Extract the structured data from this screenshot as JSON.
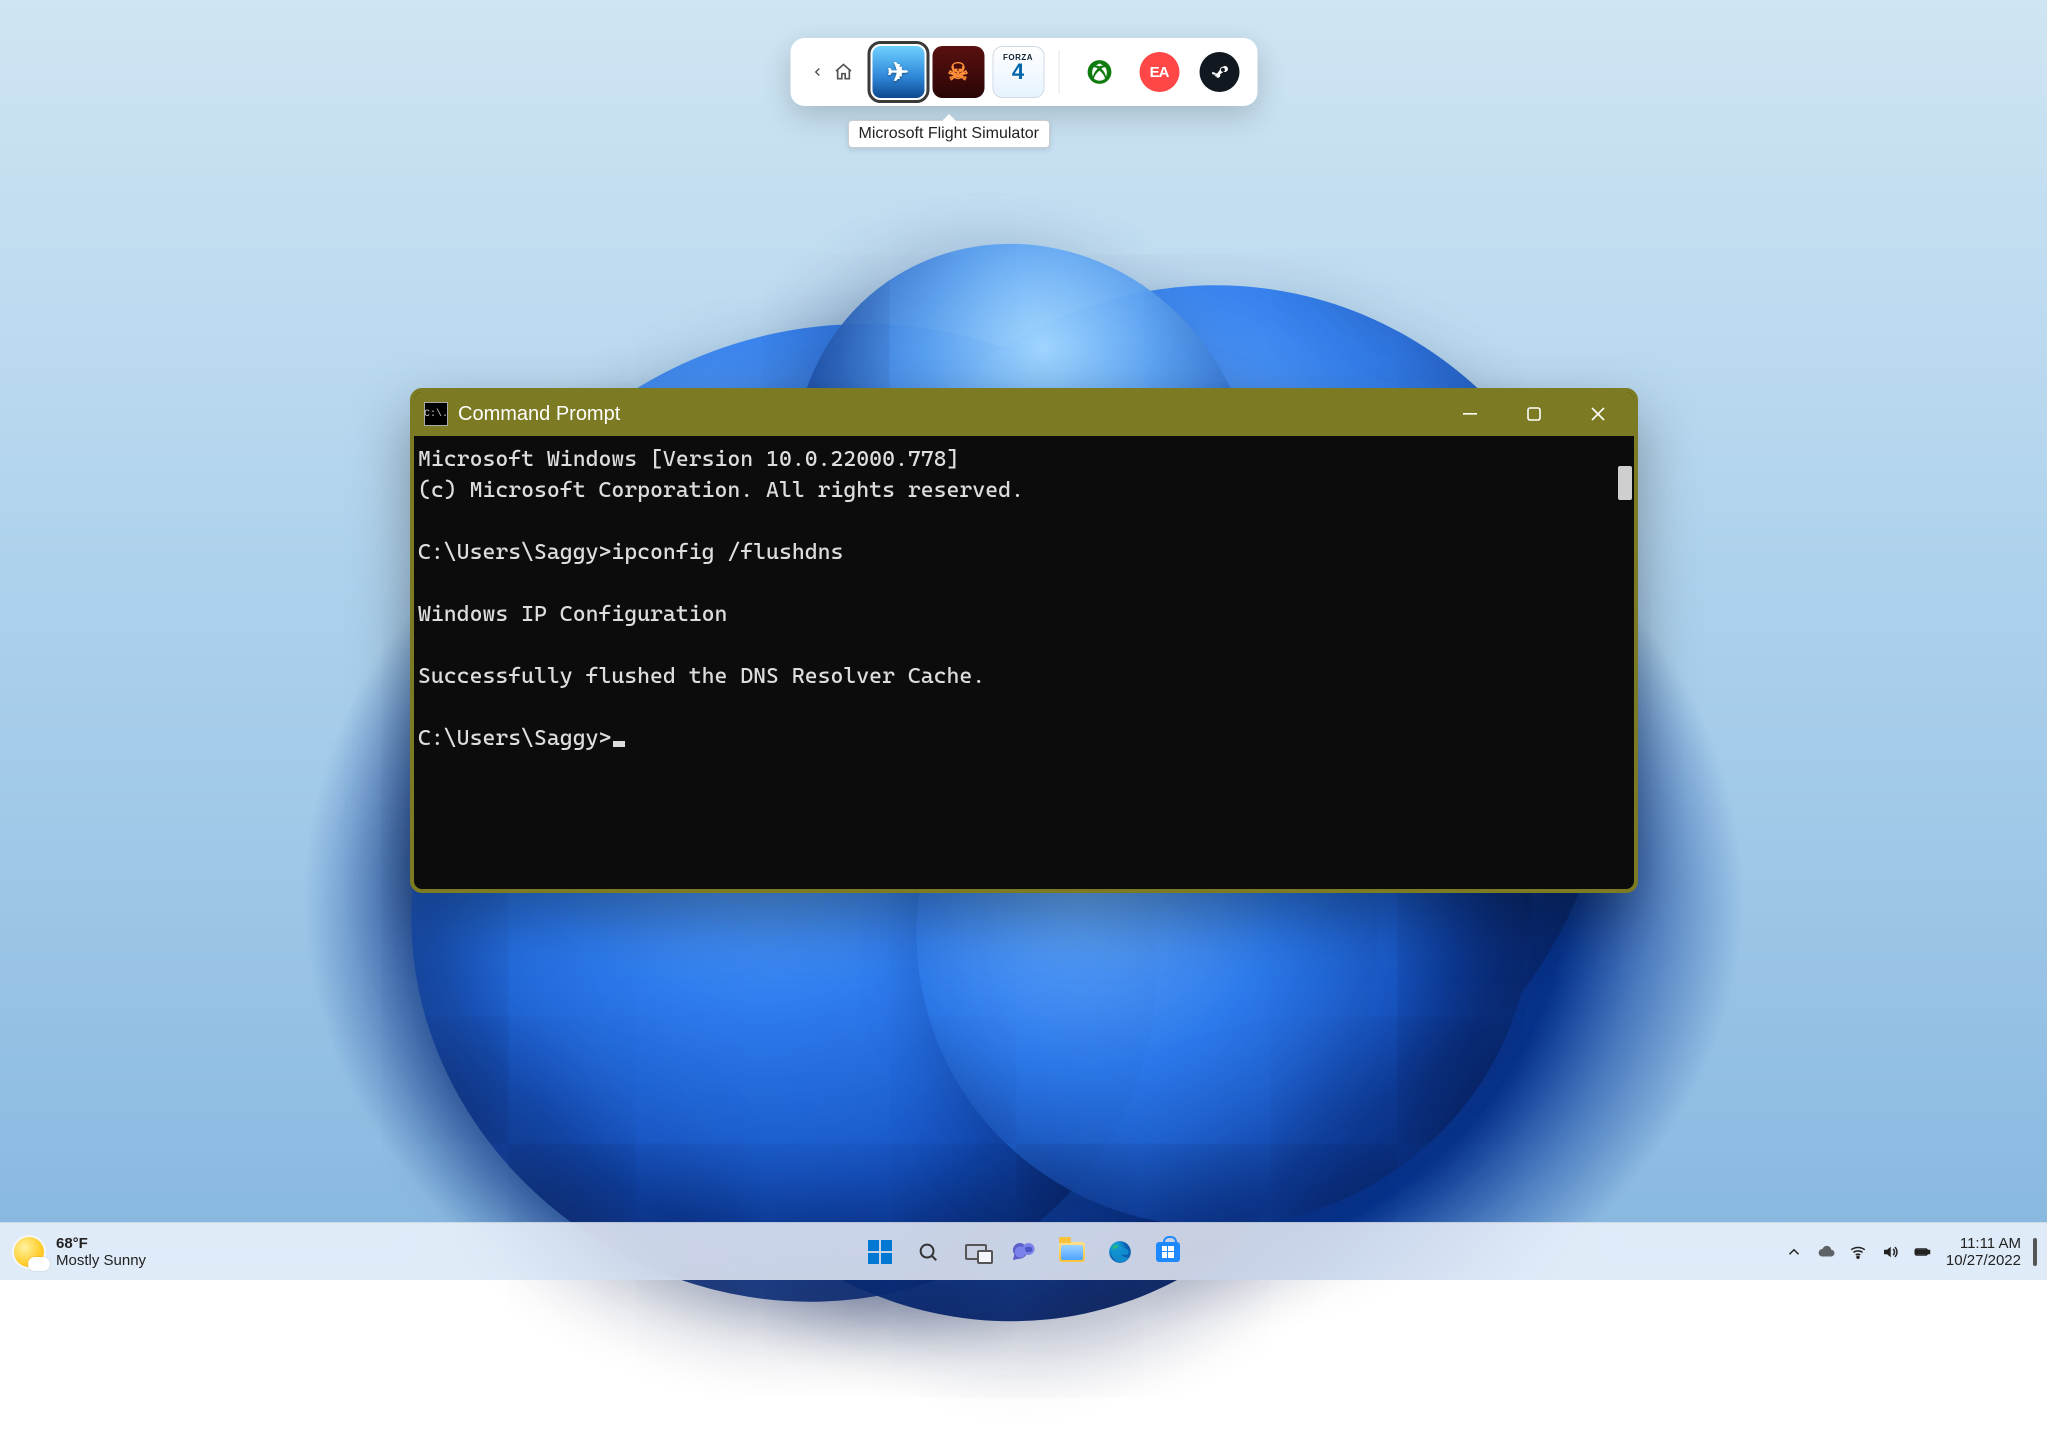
{
  "gamebar": {
    "tiles": [
      {
        "id": "msfs",
        "name": "Microsoft Flight Simulator",
        "selected": true
      },
      {
        "id": "doom",
        "name": "DOOM"
      },
      {
        "id": "forza",
        "name": "Forza Horizon 4"
      }
    ],
    "launchers": [
      {
        "id": "xbox",
        "name": "Xbox"
      },
      {
        "id": "ea",
        "name": "EA",
        "label": "EA"
      },
      {
        "id": "steam",
        "name": "Steam"
      }
    ],
    "tooltip": "Microsoft Flight Simulator"
  },
  "cmd": {
    "title": "Command Prompt",
    "icon_text": "C:\\.",
    "lines": {
      "l1": "Microsoft Windows [Version 10.0.22000.778]",
      "l2": "(c) Microsoft Corporation. All rights reserved.",
      "l3": "",
      "l4": "C:\\Users\\Saggy>ipconfig /flushdns",
      "l5": "",
      "l6": "Windows IP Configuration",
      "l7": "",
      "l8": "Successfully flushed the DNS Resolver Cache.",
      "l9": "",
      "l10": "C:\\Users\\Saggy>"
    }
  },
  "taskbar": {
    "weather": {
      "temp": "68°F",
      "desc": "Mostly Sunny"
    },
    "clock": {
      "time": "11:11 AM",
      "date": "10/27/2022"
    }
  }
}
